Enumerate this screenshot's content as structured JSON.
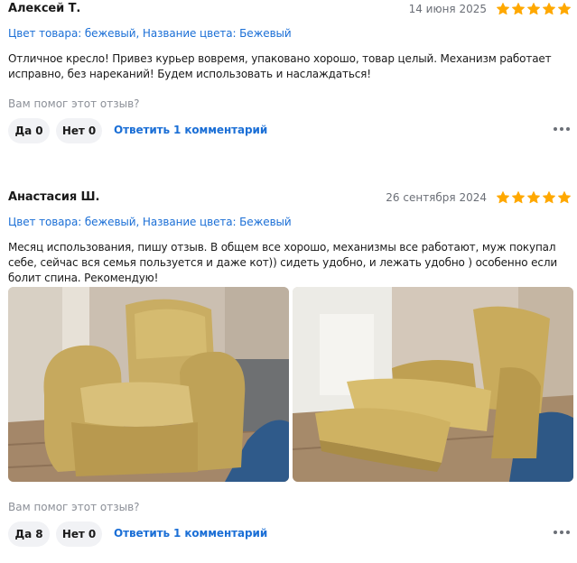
{
  "colors": {
    "accent": "#1b6fd6",
    "star": "#ffa800",
    "muted": "#8c9098",
    "pill_bg": "#f1f2f5"
  },
  "reviews": [
    {
      "author": "Алексей Т.",
      "date": "14 июня 2025",
      "rating": 5,
      "variant": "Цвет товара: бежевый, Название цвета: Бежевый",
      "text": "Отличное кресло! Привез курьер вовремя, упаковано хорошо, товар целый. Механизм работает исправно, без нареканий! Будем использовать и наслаждаться!",
      "helpful_question": "Вам помог этот отзыв?",
      "yes_label": "Да 0",
      "no_label": "Нет 0",
      "reply_label": "Ответить",
      "comments_label": "1 комментарий"
    },
    {
      "author": "Анастасия Ш.",
      "date": "26 сентября 2024",
      "rating": 5,
      "variant": "Цвет товара: бежевый, Название цвета: Бежевый",
      "text": "Месяц использования, пишу отзыв. В общем все хорошо, механизмы все работают, муж покупал себе, сейчас вся семья пользуется и даже кот)) сидеть удобно, и лежать удобно ) особенно если болит спина. Рекомендую!",
      "photos": [
        "armchair-upright-photo",
        "armchair-reclined-photo"
      ],
      "helpful_question": "Вам помог этот отзыв?",
      "yes_label": "Да 8",
      "no_label": "Нет 0",
      "reply_label": "Ответить",
      "comments_label": "1 комментарий"
    }
  ]
}
